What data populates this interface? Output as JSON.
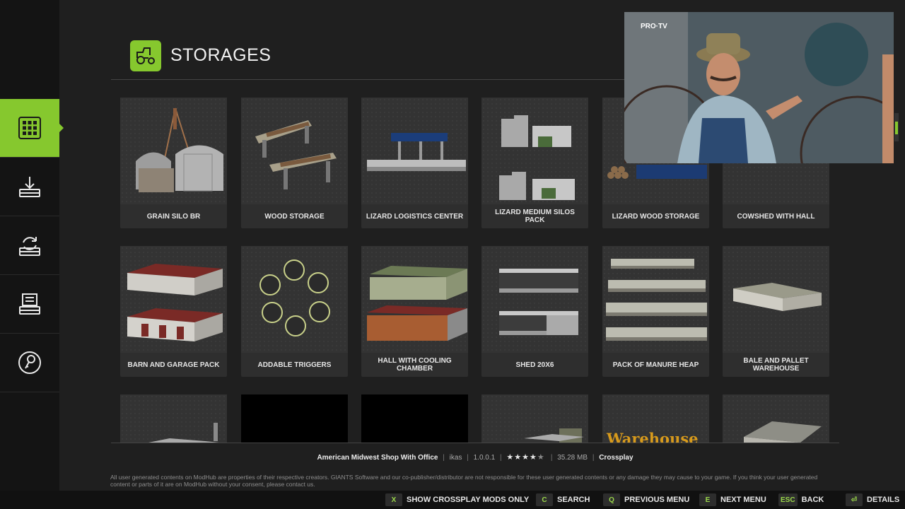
{
  "header": {
    "title": "STORAGES"
  },
  "sidebar": {
    "items": [
      {
        "icon": "grid-icon",
        "active": true
      },
      {
        "icon": "download-icon",
        "active": false
      },
      {
        "icon": "update-icon",
        "active": false
      },
      {
        "icon": "installed-icon",
        "active": false
      },
      {
        "icon": "key-icon",
        "active": false
      }
    ]
  },
  "cards": [
    {
      "label": "GRAIN SILO BR"
    },
    {
      "label": "WOOD STORAGE"
    },
    {
      "label": "LIZARD LOGISTICS CENTER"
    },
    {
      "label": "LIZARD MEDIUM SILOS PACK"
    },
    {
      "label": "LIZARD WOOD STORAGE"
    },
    {
      "label": "COWSHED WITH HALL"
    },
    {
      "label": "BARN AND GARAGE PACK"
    },
    {
      "label": "ADDABLE TRIGGERS"
    },
    {
      "label": "HALL WITH COOLING CHAMBER"
    },
    {
      "label": "SHED 20X6"
    },
    {
      "label": "PACK OF MANURE HEAP"
    },
    {
      "label": "BALE AND PALLET WAREHOUSE"
    },
    {
      "label": ""
    },
    {
      "label": ""
    },
    {
      "label": ""
    },
    {
      "label": ""
    },
    {
      "label": ""
    },
    {
      "label": ""
    }
  ],
  "thumb_text": {
    "warehouse": "Warehouse"
  },
  "info": {
    "name": "American Midwest Shop With Office",
    "author": "ikas",
    "version": "1.0.0.1",
    "rating": 4.5,
    "size": "35.28 MB",
    "crossplay": "Crossplay"
  },
  "disclaimer": "All user generated contents on ModHub are properties of their respective creators. GIANTS Software and our co-publisher/distributor are not responsible for these user generated contents or any damage they may cause to your game. If you think your user generated content or parts of it are on ModHub without your consent, please contact us.",
  "actions": [
    {
      "key": "X",
      "label": "SHOW CROSSPLAY MODS ONLY"
    },
    {
      "key": "C",
      "label": "SEARCH"
    },
    {
      "key": "Q",
      "label": "PREVIOUS MENU"
    },
    {
      "key": "E",
      "label": "NEXT MENU"
    },
    {
      "key": "ESC",
      "label": "BACK"
    },
    {
      "key": "⏎",
      "label": "DETAILS"
    }
  ],
  "video": {
    "channel": "PRO·TV"
  },
  "colors": {
    "accent": "#86c82e",
    "background": "#1f1f1f",
    "sidebar": "#141414"
  }
}
